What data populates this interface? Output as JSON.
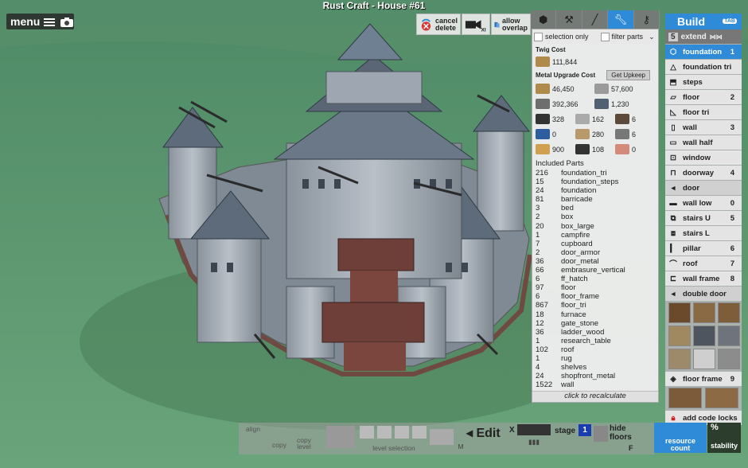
{
  "window": {
    "title": "Rust Craft - House #61"
  },
  "menu": {
    "label": "menu"
  },
  "top_buttons": {
    "cancel_delete": "cancel\ndelete",
    "allow_overlap": "allow\noverlap"
  },
  "tool_tabs": [
    "cube-icon",
    "hammer-icon",
    "pickaxe-icon",
    "wrench-icon",
    "key-icon"
  ],
  "options": {
    "selection_only": "selection only",
    "filter_parts": "filter parts"
  },
  "costs": {
    "twig_cost_label": "Twig Cost",
    "twig_cost_value": "111,844",
    "metal_upgrade_label": "Metal Upgrade Cost",
    "upkeep_button": "Get Upkeep",
    "rows": [
      [
        {
          "icon": "wood-icon",
          "value": "46,450"
        },
        {
          "icon": "stone-icon",
          "value": "57,600"
        }
      ],
      [
        {
          "icon": "metal-frags-icon",
          "value": "392,366"
        },
        {
          "icon": "hqm-icon",
          "value": "1,230"
        }
      ],
      [
        {
          "icon": "gear-part-icon",
          "value": "328"
        },
        {
          "icon": "sheet-metal-icon",
          "value": "162"
        },
        {
          "icon": "pipe-icon",
          "value": "6"
        }
      ],
      [
        {
          "icon": "tarp-icon",
          "value": "0"
        },
        {
          "icon": "rope-icon",
          "value": "280"
        },
        {
          "icon": "spring-icon",
          "value": "6"
        }
      ],
      [
        {
          "icon": "cloth-icon",
          "value": "900"
        },
        {
          "icon": "lowgrade-icon",
          "value": "108"
        },
        {
          "icon": "leather-icon",
          "value": "0"
        }
      ]
    ]
  },
  "included_parts": {
    "title": "Included Parts",
    "items": [
      {
        "count": "216",
        "name": "foundation_tri"
      },
      {
        "count": "15",
        "name": "foundation_steps"
      },
      {
        "count": "24",
        "name": "foundation"
      },
      {
        "count": "81",
        "name": "barricade"
      },
      {
        "count": "3",
        "name": "bed"
      },
      {
        "count": "2",
        "name": "box"
      },
      {
        "count": "20",
        "name": "box_large"
      },
      {
        "count": "1",
        "name": "campfire"
      },
      {
        "count": "7",
        "name": "cupboard"
      },
      {
        "count": "2",
        "name": "door_armor"
      },
      {
        "count": "36",
        "name": "door_metal"
      },
      {
        "count": "66",
        "name": "embrasure_vertical"
      },
      {
        "count": "6",
        "name": "ff_hatch"
      },
      {
        "count": "97",
        "name": "floor"
      },
      {
        "count": "6",
        "name": "floor_frame"
      },
      {
        "count": "867",
        "name": "floor_tri"
      },
      {
        "count": "18",
        "name": "furnace"
      },
      {
        "count": "12",
        "name": "gate_stone"
      },
      {
        "count": "36",
        "name": "ladder_wood"
      },
      {
        "count": "1",
        "name": "research_table"
      },
      {
        "count": "102",
        "name": "roof"
      },
      {
        "count": "1",
        "name": "rug"
      },
      {
        "count": "4",
        "name": "shelves"
      },
      {
        "count": "24",
        "name": "shopfront_metal"
      },
      {
        "count": "1522",
        "name": "wall"
      }
    ],
    "recalc": "click to recalculate"
  },
  "build": {
    "title": "Build",
    "tab_hint": "TAB",
    "extend_count": "5",
    "extend_label": "extend",
    "items": [
      {
        "label": "foundation",
        "key": "1",
        "icon": "foundation-icon",
        "active": true
      },
      {
        "label": "foundation tri",
        "key": "",
        "icon": "foundation-tri-icon"
      },
      {
        "label": "steps",
        "key": "",
        "icon": "steps-icon"
      },
      {
        "label": "floor",
        "key": "2",
        "icon": "floor-icon"
      },
      {
        "label": "floor tri",
        "key": "",
        "icon": "floor-tri-icon"
      },
      {
        "label": "wall",
        "key": "3",
        "icon": "wall-icon"
      },
      {
        "label": "wall half",
        "key": "",
        "icon": "wall-half-icon"
      },
      {
        "label": "window",
        "key": "",
        "icon": "window-icon"
      },
      {
        "label": "doorway",
        "key": "4",
        "icon": "doorway-icon"
      },
      {
        "label": "door",
        "key": "",
        "icon": "door-icon",
        "sub": true
      },
      {
        "label": "wall low",
        "key": "0",
        "icon": "wall-low-icon"
      },
      {
        "label": "stairs U",
        "key": "5",
        "icon": "stairs-u-icon"
      },
      {
        "label": "stairs L",
        "key": "",
        "icon": "stairs-l-icon"
      },
      {
        "label": "pillar",
        "key": "6",
        "icon": "pillar-icon"
      },
      {
        "label": "roof",
        "key": "7",
        "icon": "roof-icon"
      },
      {
        "label": "wall frame",
        "key": "8",
        "icon": "wall-frame-icon"
      },
      {
        "label": "double door",
        "key": "",
        "icon": "double-door-icon",
        "sub": true
      }
    ],
    "floor_frame_label": "floor frame",
    "floor_frame_key": "9",
    "code_locks": "add code locks"
  },
  "bottom": {
    "align": "align",
    "copy": "copy",
    "copy_level": "copy\nlevel",
    "level_selection": "level selection",
    "m_key": "M",
    "edit": "Edit",
    "x_key": "X",
    "stage_label": "stage",
    "stage_value": "1",
    "f_key": "F",
    "hide_floors": "hide\nfloors",
    "resource_count": "resource\ncount",
    "stability": "stability",
    "percent": "%"
  }
}
